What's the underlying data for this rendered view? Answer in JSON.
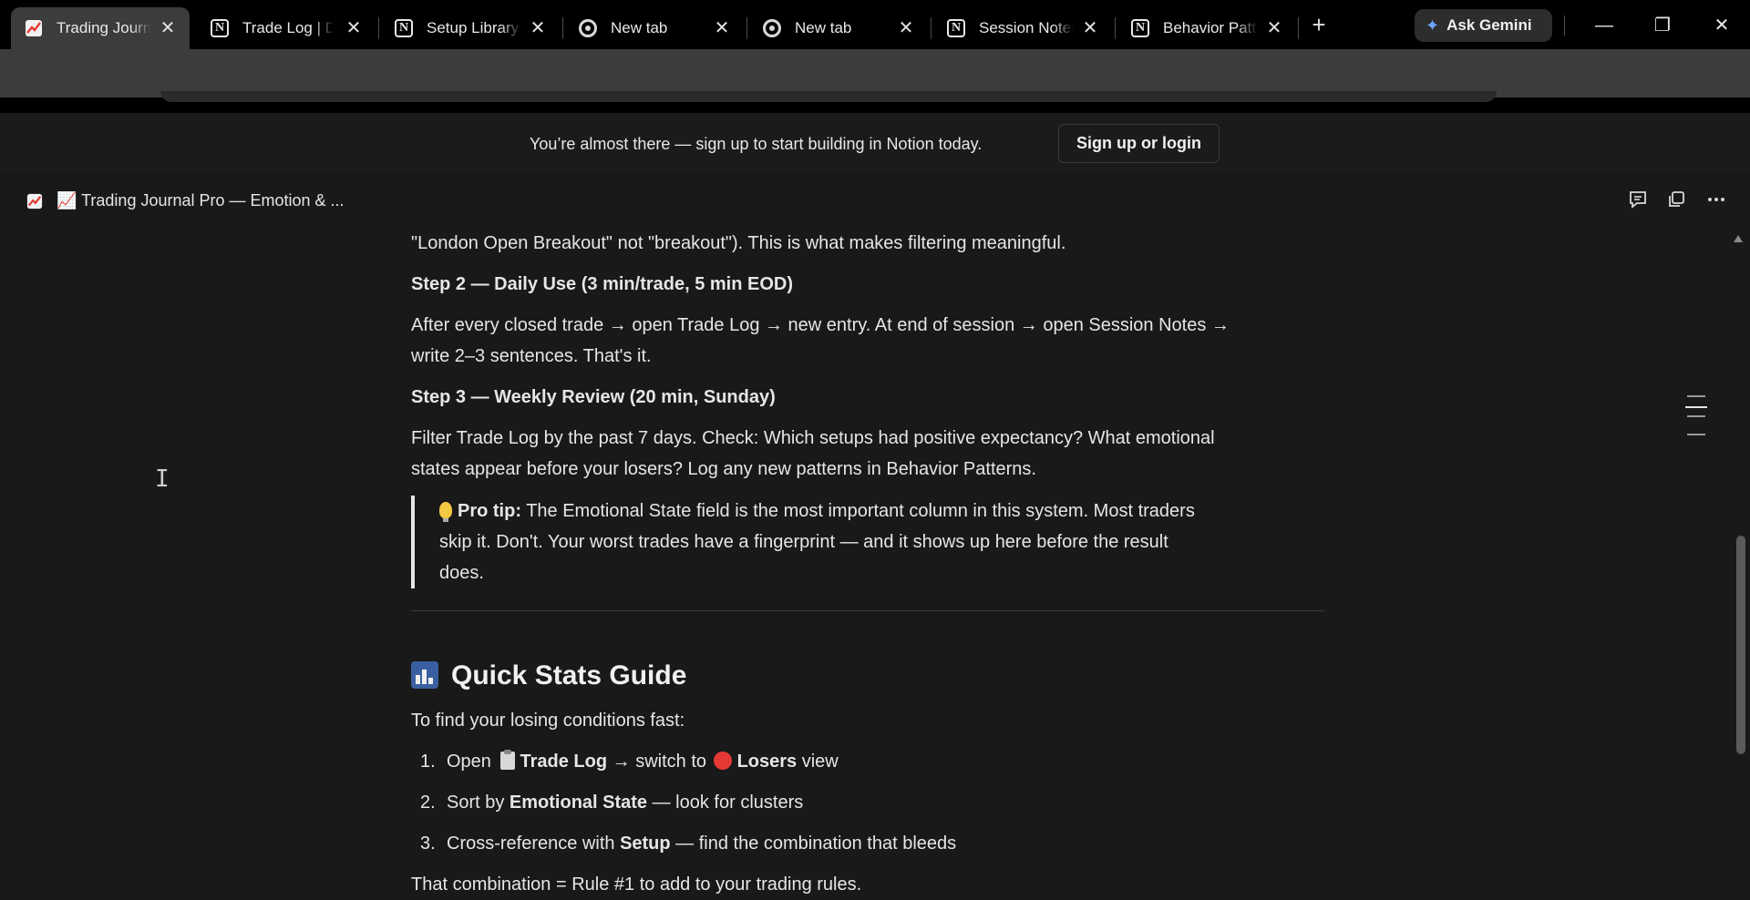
{
  "browser": {
    "tabs": [
      {
        "title": "Trading Journal Pro",
        "icon": "chart-up-icon",
        "active": true
      },
      {
        "title": "Trade Log | Database",
        "icon": "notion-icon",
        "active": false
      },
      {
        "title": "Setup Library",
        "icon": "notion-icon",
        "active": false
      },
      {
        "title": "New tab",
        "icon": "chrome-icon",
        "active": false
      },
      {
        "title": "New tab",
        "icon": "chrome-icon",
        "active": false
      },
      {
        "title": "Session Notes",
        "icon": "notion-icon",
        "active": false
      },
      {
        "title": "Behavior Patterns",
        "icon": "notion-icon",
        "active": false
      }
    ],
    "close_glyph": "✕",
    "new_tab_glyph": "+",
    "gemini_label": "Ask Gemini",
    "window_controls": {
      "minimize": "—",
      "restore": "❐",
      "close": "✕"
    }
  },
  "banner": {
    "text": "You’re almost there — sign up to start building in Notion today.",
    "button": "Sign up or login"
  },
  "page_header": {
    "title": "📈 Trading Journal Pro — Emotion & ..."
  },
  "content": {
    "line1": "\"London Open Breakout\" not \"breakout\"). This is what makes filtering meaningful.",
    "step2_heading": "Step 2 — Daily Use (3 min/trade, 5 min EOD)",
    "step2_text_1": "After every closed trade → open Trade Log → new entry. At end of session → open Session Notes →",
    "step2_text_2": "write 2–3 sentences. That's it.",
    "step3_heading": "Step 3 — Weekly Review (20 min, Sunday)",
    "step3_text_1": "Filter Trade Log by the past 7 days. Check: Which setups had positive expectancy? What emotional",
    "step3_text_2": "states appear before your losers? Log any new patterns in Behavior Patterns.",
    "tip_label": "Pro tip:",
    "tip_text_1": " The Emotional State field is the most important column in this system. Most traders",
    "tip_text_2": "skip it. Don't. Your worst trades have a fingerprint — and it shows up here before the result",
    "tip_text_3": "does.",
    "section_title": "Quick Stats Guide",
    "intro": "To find your losing conditions fast:",
    "list": [
      {
        "num": "1.",
        "pre": "Open",
        "bold1": "Trade Log",
        "mid": " → switch to",
        "bold2": "Losers",
        "post": " view"
      },
      {
        "num": "2.",
        "pre": "Sort by ",
        "bold1": "Emotional State",
        "post": " — look for clusters"
      },
      {
        "num": "3.",
        "pre": "Cross-reference with ",
        "bold1": "Setup",
        "post": " — find the combination that bleeds"
      }
    ],
    "outro": "That combination = Rule #1 to add to your trading rules."
  }
}
